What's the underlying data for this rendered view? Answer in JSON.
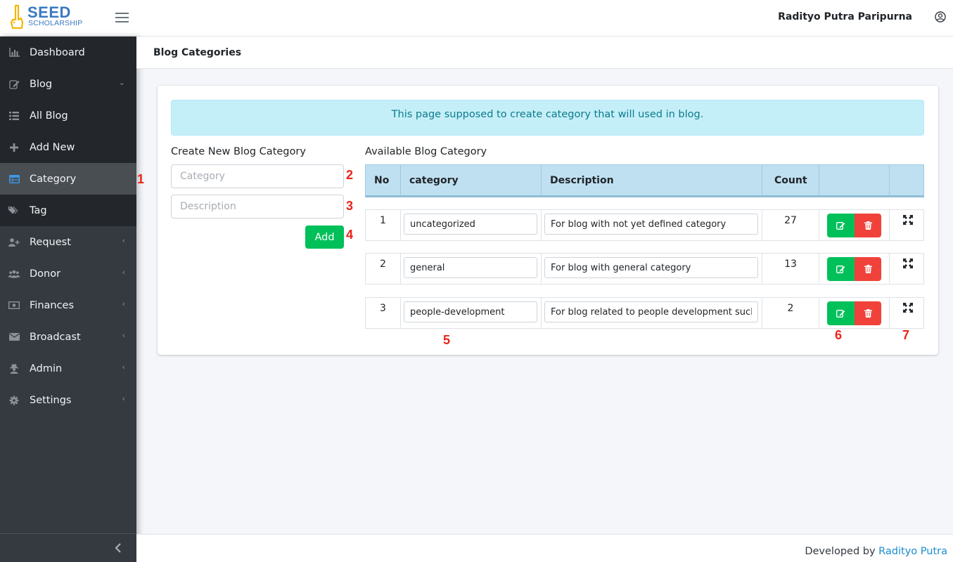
{
  "brand": {
    "name": "SEED",
    "tagline": "SCHOLARSHIP"
  },
  "header": {
    "user_name": "Radityo Putra Paripurna"
  },
  "sidebar": {
    "items": [
      {
        "label": "Dashboard",
        "icon": "bar-chart-icon",
        "caret": ""
      },
      {
        "label": "Blog",
        "icon": "edit-icon",
        "caret": "⌄"
      },
      {
        "label": "All Blog",
        "icon": "list-icon",
        "caret": ""
      },
      {
        "label": "Add New",
        "icon": "plus-icon",
        "caret": ""
      },
      {
        "label": "Category",
        "icon": "table-icon",
        "caret": ""
      },
      {
        "label": "Tag",
        "icon": "tags-icon",
        "caret": ""
      },
      {
        "label": "Request",
        "icon": "user-plus-icon",
        "caret": "‹"
      },
      {
        "label": "Donor",
        "icon": "users-icon",
        "caret": "‹"
      },
      {
        "label": "Finances",
        "icon": "money-icon",
        "caret": "‹"
      },
      {
        "label": "Broadcast",
        "icon": "envelope-icon",
        "caret": "‹"
      },
      {
        "label": "Admin",
        "icon": "user-secret-icon",
        "caret": "‹"
      },
      {
        "label": "Settings",
        "icon": "cog-icon",
        "caret": "‹"
      }
    ]
  },
  "page": {
    "title": "Blog Categories",
    "alert": "This page supposed to create category that will used in blog."
  },
  "form": {
    "title": "Create New Blog Category",
    "category_placeholder": "Category",
    "description_placeholder": "Description",
    "add_label": "Add"
  },
  "table": {
    "title": "Available Blog Category",
    "headers": {
      "no": "No",
      "category": "category",
      "description": "Description",
      "count": "Count"
    },
    "rows": [
      {
        "no": "1",
        "category": "uncategorized",
        "description": "For blog with not yet defined category",
        "count": "27"
      },
      {
        "no": "2",
        "category": "general",
        "description": "For blog with general category",
        "count": "13"
      },
      {
        "no": "3",
        "category": "people-development",
        "description": "For blog related to people development such as",
        "count": "2"
      }
    ]
  },
  "markers": [
    "1",
    "2",
    "3",
    "4",
    "5",
    "6",
    "7"
  ],
  "footer": {
    "prefix": "Developed by",
    "author": "Radityo Putra"
  },
  "colors": {
    "sidebar": "#343a40",
    "active_icon": "#3d9be9",
    "success": "#00c05a",
    "danger": "#f0423a",
    "info_bg": "#c5eff8",
    "table_head": "#bfe0f1",
    "marker": "#e8251a"
  }
}
